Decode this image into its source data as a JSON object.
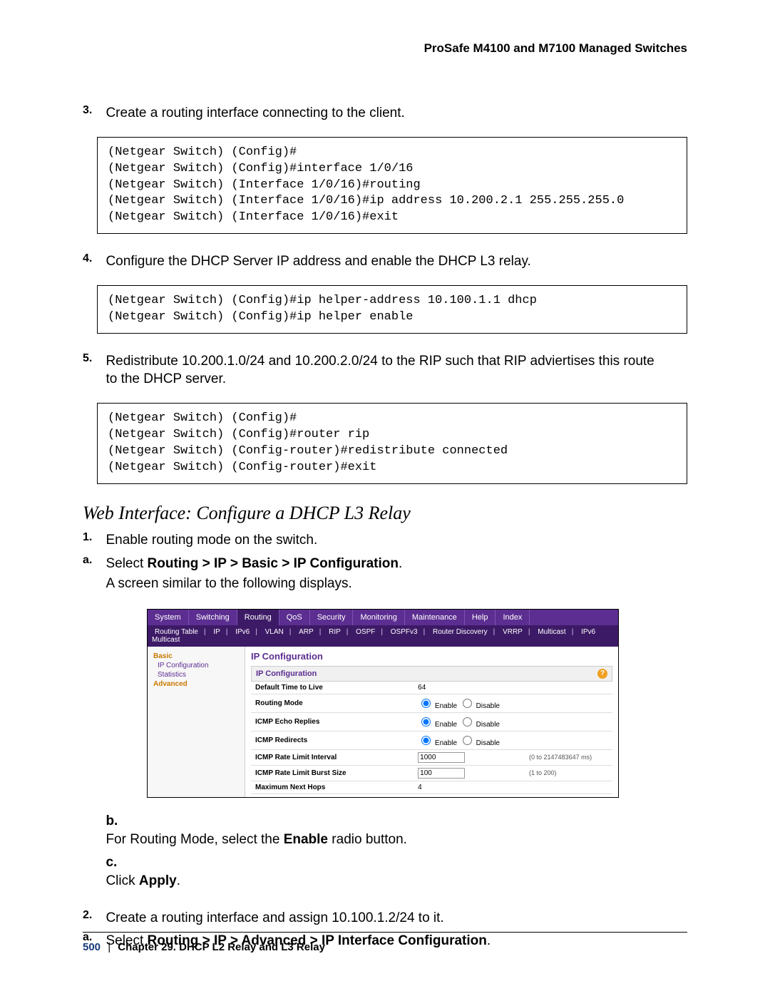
{
  "header": "ProSafe M4100 and M7100 Managed Switches",
  "steps": {
    "s3": {
      "num": "3.",
      "text": "Create a routing interface connecting to the client."
    },
    "code3": "(Netgear Switch) (Config)#\n(Netgear Switch) (Config)#interface 1/0/16\n(Netgear Switch) (Interface 1/0/16)#routing\n(Netgear Switch) (Interface 1/0/16)#ip address 10.200.2.1 255.255.255.0\n(Netgear Switch) (Interface 1/0/16)#exit",
    "s4": {
      "num": "4.",
      "text": "Configure the DHCP Server IP address and enable the DHCP L3 relay."
    },
    "code4": "(Netgear Switch) (Config)#ip helper-address 10.100.1.1 dhcp\n(Netgear Switch) (Config)#ip helper enable",
    "s5": {
      "num": "5.",
      "text": "Redistribute 10.200.1.0/24 and 10.200.2.0/24 to the RIP such that RIP adviertises this route to the DHCP server."
    },
    "code5": "(Netgear Switch) (Config)#\n(Netgear Switch) (Config)#router rip\n(Netgear Switch) (Config-router)#redistribute connected\n(Netgear Switch) (Config-router)#exit"
  },
  "section_title": "Web Interface: Configure a DHCP L3 Relay",
  "web": {
    "s1": {
      "num": "1.",
      "text": "Enable routing mode on the switch."
    },
    "a": {
      "num": "a.",
      "prefix": "Select ",
      "bold": "Routing > IP > Basic > IP Configuration",
      "suffix": ".",
      "line2": "A screen similar to the following displays."
    },
    "b": {
      "num": "b.",
      "prefix": "For Routing Mode, select the ",
      "bold": "Enable",
      "suffix": " radio button."
    },
    "c": {
      "num": "c.",
      "prefix": "Click ",
      "bold": "Apply",
      "suffix": "."
    },
    "s2": {
      "num": "2.",
      "text": "Create a routing interface and assign 10.100.1.2/24 to it."
    },
    "a2": {
      "num": "a.",
      "prefix": "Select ",
      "bold": "Routing > IP > Advanced > IP Interface Configuration",
      "suffix": "."
    }
  },
  "ui": {
    "tabs": [
      "System",
      "Switching",
      "Routing",
      "QoS",
      "Security",
      "Monitoring",
      "Maintenance",
      "Help",
      "Index"
    ],
    "active_tab": "Routing",
    "subnav": [
      "Routing Table",
      "IP",
      "IPv6",
      "VLAN",
      "ARP",
      "RIP",
      "OSPF",
      "OSPFv3",
      "Router Discovery",
      "VRRP",
      "Multicast",
      "IPv6 Multicast"
    ],
    "side": {
      "g1": "Basic",
      "i1": "IP Configuration",
      "i2": "Statistics",
      "g2": "Advanced"
    },
    "title": "IP Configuration",
    "panel": "IP Configuration",
    "rows": {
      "ttl": {
        "l": "Default Time to Live",
        "v": "64"
      },
      "routing": {
        "l": "Routing Mode",
        "e": "Enable",
        "d": "Disable"
      },
      "echo": {
        "l": "ICMP Echo Replies",
        "e": "Enable",
        "d": "Disable"
      },
      "redir": {
        "l": "ICMP Redirects",
        "e": "Enable",
        "d": "Disable"
      },
      "rli": {
        "l": "ICMP Rate Limit Interval",
        "v": "1000",
        "h": "(0 to 2147483647 ms)"
      },
      "rlb": {
        "l": "ICMP Rate Limit Burst Size",
        "v": "100",
        "h": "(1 to 200)"
      },
      "hops": {
        "l": "Maximum Next Hops",
        "v": "4"
      }
    },
    "help": "?"
  },
  "footer": {
    "page": "500",
    "chapter": "Chapter 29.  DHCP L2 Relay and L3 Relay"
  }
}
